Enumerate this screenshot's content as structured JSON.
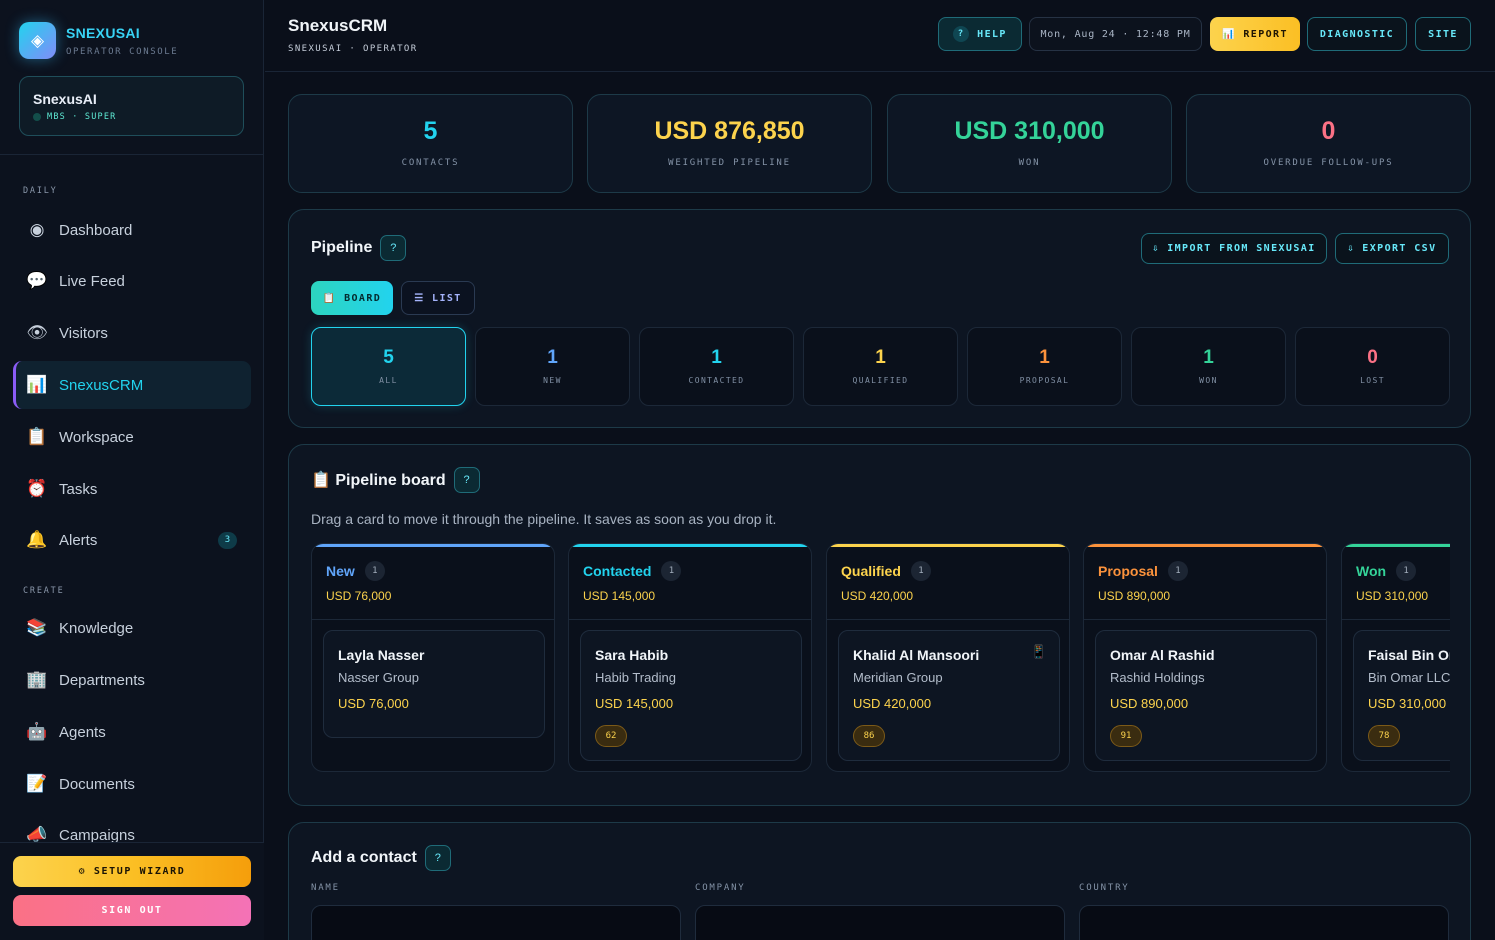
{
  "brand": {
    "name": "SNEXUSAI",
    "subtitle": "OPERATOR CONSOLE",
    "logo_icon": "diamond-icon"
  },
  "account": {
    "name": "SnexusAI",
    "tier": "MBS · SUPER"
  },
  "sidebar": {
    "sections": [
      {
        "label": "DAILY",
        "items": [
          {
            "label": "Dashboard",
            "icon": "◉",
            "active": false
          },
          {
            "label": "Live Feed",
            "icon": "💬",
            "active": false
          },
          {
            "label": "Visitors",
            "icon": "👁",
            "active": false
          },
          {
            "label": "SnexusCRM",
            "icon": "📊",
            "active": true
          },
          {
            "label": "Workspace",
            "icon": "📋",
            "active": false
          },
          {
            "label": "Tasks",
            "icon": "⏰",
            "active": false
          },
          {
            "label": "Alerts",
            "icon": "🔔",
            "active": false,
            "badge": "3"
          }
        ]
      },
      {
        "label": "CREATE",
        "items": [
          {
            "label": "Knowledge",
            "icon": "📚"
          },
          {
            "label": "Departments",
            "icon": "🏢"
          },
          {
            "label": "Agents",
            "icon": "🤖"
          },
          {
            "label": "Documents",
            "icon": "📝"
          },
          {
            "label": "Campaigns",
            "icon": "📣"
          }
        ]
      }
    ],
    "setup_label": "⚙ SETUP WIZARD",
    "signout_label": "SIGN OUT"
  },
  "header": {
    "title": "SnexusCRM",
    "subtitle": "SNEXUSAI · OPERATOR",
    "help_label": "HELP",
    "clock": "Mon, Aug 24 · 12:48 PM",
    "report_label": "📊 REPORT",
    "diagnostic_label": "DIAGNOSTIC",
    "site_label": "SITE"
  },
  "stats": [
    {
      "value": "5",
      "label": "CONTACTS",
      "color": "#22d3ee"
    },
    {
      "value": "USD 876,850",
      "label": "WEIGHTED PIPELINE",
      "color": "#fcd34d"
    },
    {
      "value": "USD 310,000",
      "label": "WON",
      "color": "#34d399"
    },
    {
      "value": "0",
      "label": "OVERDUE FOLLOW-UPS",
      "color": "#fb7185"
    }
  ],
  "pipeline": {
    "title": "Pipeline",
    "help": "?",
    "import_label": "⇩ IMPORT FROM SNEXUSAI",
    "export_label": "⇩ EXPORT CSV",
    "board_label": "📋 BOARD",
    "list_label": "☰ LIST",
    "stages": [
      {
        "count": "5",
        "label": "ALL",
        "color": "#22d3ee"
      },
      {
        "count": "1",
        "label": "NEW",
        "color": "#60a5fa"
      },
      {
        "count": "1",
        "label": "CONTACTED",
        "color": "#22d3ee"
      },
      {
        "count": "1",
        "label": "QUALIFIED",
        "color": "#fcd34d"
      },
      {
        "count": "1",
        "label": "PROPOSAL",
        "color": "#fb923c"
      },
      {
        "count": "1",
        "label": "WON",
        "color": "#34d399"
      },
      {
        "count": "0",
        "label": "LOST",
        "color": "#fb7185"
      }
    ]
  },
  "board": {
    "title": "📋 Pipeline board",
    "help": "?",
    "description": "Drag a card to move it through the pipeline. It saves as soon as you drop it.",
    "columns": [
      {
        "name": "New",
        "count": "1",
        "total": "USD 76,000",
        "color": "#60a5fa",
        "card": {
          "name": "Layla Nasser",
          "company": "Nasser Group",
          "amount": "USD 76,000",
          "score": ""
        }
      },
      {
        "name": "Contacted",
        "count": "1",
        "total": "USD 145,000",
        "color": "#22d3ee",
        "card": {
          "name": "Sara Habib",
          "company": "Habib Trading",
          "amount": "USD 145,000",
          "score": "62"
        }
      },
      {
        "name": "Qualified",
        "count": "1",
        "total": "USD 420,000",
        "color": "#fcd34d",
        "card": {
          "name": "Khalid Al Mansoori",
          "company": "Meridian Group",
          "amount": "USD 420,000",
          "score": "86",
          "icon": "📱"
        }
      },
      {
        "name": "Proposal",
        "count": "1",
        "total": "USD 890,000",
        "color": "#fb923c",
        "card": {
          "name": "Omar Al Rashid",
          "company": "Rashid Holdings",
          "amount": "USD 890,000",
          "score": "91"
        }
      },
      {
        "name": "Won",
        "count": "1",
        "total": "USD 310,000",
        "color": "#34d399",
        "card": {
          "name": "Faisal Bin Omar",
          "company": "Bin Omar LLC",
          "amount": "USD 310,000",
          "score": "78"
        }
      }
    ]
  },
  "contact_form": {
    "title": "Add a contact",
    "help": "?",
    "fields": [
      {
        "label": "NAME",
        "value": ""
      },
      {
        "label": "COMPANY",
        "value": ""
      },
      {
        "label": "COUNTRY",
        "value": ""
      }
    ]
  }
}
